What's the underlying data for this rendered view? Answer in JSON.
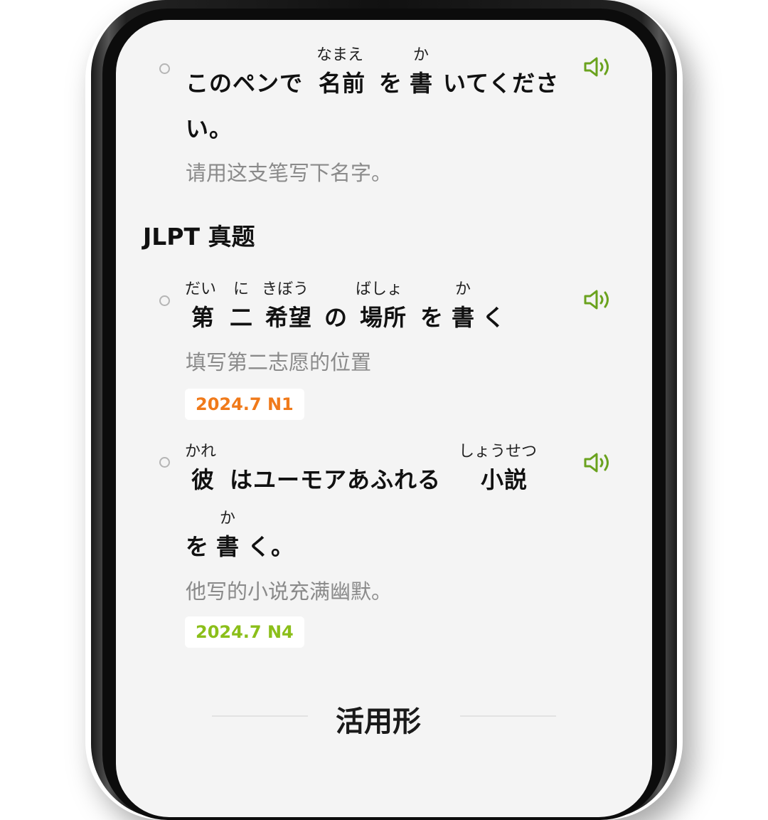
{
  "examples": [
    {
      "line1": "このペンで",
      "ruby_namae": "なまえ",
      "kanji_namae": "名前",
      "particle_wo": "を",
      "ruby_ka": "か",
      "kanji_kaku": "書",
      "rest": "いてくださ",
      "line2": "い。",
      "translation": "请用这支笔写下名字。"
    }
  ],
  "section": {
    "title": "JLPT 真题"
  },
  "questions": [
    {
      "ruby_dai": "だい",
      "kanji_dai": "第",
      "ruby_ni": "に",
      "kanji_ni": "二",
      "ruby_kibou": "きぼう",
      "kanji_kibou": "希望",
      "particle_no": "の",
      "ruby_basho": "ばしょ",
      "kanji_basho": "場所",
      "particle_wo": "を",
      "ruby_ka": "か",
      "kanji_kaku": "書",
      "okurigana": "く",
      "translation": "填写第二志愿的位置",
      "tag": "2024.7 N1",
      "tag_color": "#f07a1a"
    },
    {
      "ruby_kare": "かれ",
      "kanji_kare": "彼",
      "middle": "はユーモアあふれる",
      "ruby_shousetsu": "しょうせつ",
      "kanji_shousetsu": "小説",
      "particle_wo": "を",
      "ruby_ka": "か",
      "kanji_kaku": "書",
      "ending": "く。",
      "translation": "他写的小说充满幽默。",
      "tag": "2024.7 N4",
      "tag_color": "#8bbf1a"
    }
  ],
  "footer": {
    "title": "活用形"
  },
  "icons": {
    "speaker": "speaker-icon",
    "accent": "#6aa21e"
  }
}
